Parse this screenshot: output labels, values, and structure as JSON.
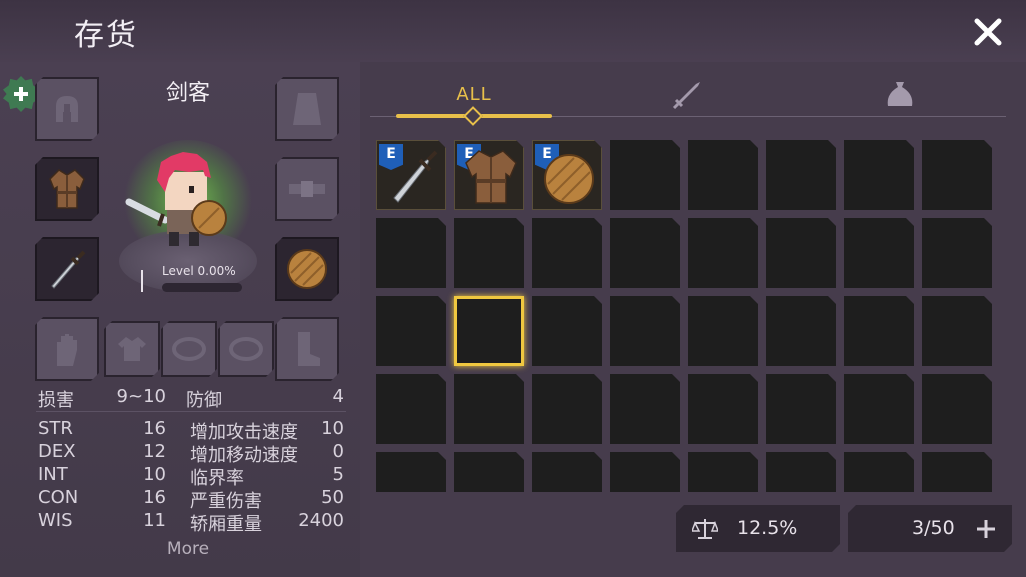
{
  "header": {
    "title": "存货"
  },
  "character": {
    "name": "剑客",
    "level_text": "Level  0.00%",
    "level_progress": 0
  },
  "equipment": {
    "slots": [
      {
        "name": "helmet",
        "icon": "helmet-icon",
        "filled": false
      },
      {
        "name": "cape",
        "icon": "cape-icon",
        "filled": false
      },
      {
        "name": "armor",
        "icon": "tunic-icon",
        "filled": true
      },
      {
        "name": "belt",
        "icon": "belt-icon",
        "filled": false
      },
      {
        "name": "weapon",
        "icon": "sword-icon",
        "filled": true
      },
      {
        "name": "shield",
        "icon": "wooden-shield-icon",
        "filled": true
      },
      {
        "name": "gloves",
        "icon": "glove-icon",
        "filled": false
      },
      {
        "name": "shirt",
        "icon": "shirt-icon",
        "filled": false
      },
      {
        "name": "ring1",
        "icon": "ring-icon",
        "filled": false
      },
      {
        "name": "ring2",
        "icon": "ring-icon",
        "filled": false
      },
      {
        "name": "boots",
        "icon": "boot-icon",
        "filled": false
      }
    ]
  },
  "stats": {
    "damage_label": "损害",
    "damage_value": "9~10",
    "defense_label": "防御",
    "defense_value": "4",
    "left": [
      {
        "label": "STR",
        "value": "16"
      },
      {
        "label": "DEX",
        "value": "12"
      },
      {
        "label": "INT",
        "value": "10"
      },
      {
        "label": "CON",
        "value": "16"
      },
      {
        "label": "WIS",
        "value": "11"
      }
    ],
    "right": [
      {
        "label": "增加攻击速度",
        "value": "10"
      },
      {
        "label": "增加移动速度",
        "value": "0"
      },
      {
        "label": "临界率",
        "value": "5"
      },
      {
        "label": "严重伤害",
        "value": "50"
      },
      {
        "label": "轿厢重量",
        "value": "2400"
      }
    ],
    "more_label": "More"
  },
  "tabs": [
    {
      "label": "ALL",
      "icon": null,
      "active": true
    },
    {
      "label": "",
      "icon": "sword-icon",
      "active": false
    },
    {
      "label": "",
      "icon": "bag-icon",
      "active": false
    }
  ],
  "inventory": {
    "items": [
      {
        "icon": "sword-icon",
        "badge": "E"
      },
      {
        "icon": "tunic-icon",
        "badge": "E"
      },
      {
        "icon": "wooden-shield-icon",
        "badge": "E"
      }
    ],
    "selected_index": 9
  },
  "footer": {
    "weight_icon": "scale-icon",
    "weight_text": "12.5%",
    "capacity_text": "3/50",
    "add_icon": "plus-icon"
  },
  "colors": {
    "accent": "#e8c04a",
    "badge_blue": "#1f5fb8",
    "glow_green": "#82e650",
    "background": "#463c4c"
  }
}
